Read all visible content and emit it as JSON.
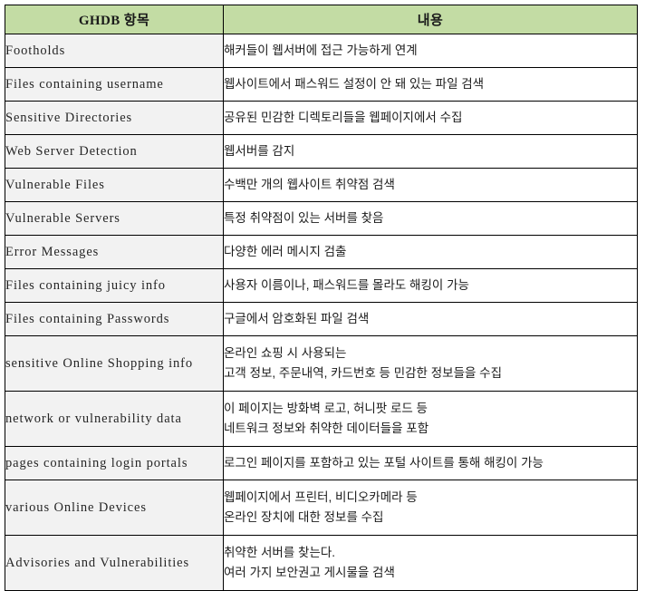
{
  "table": {
    "headers": {
      "term": "GHDB 항목",
      "description": "내용"
    },
    "header_bg": "#c3dca4",
    "term_bg": "#f2f2f2",
    "desc_bg": "#ffffff",
    "border_color": "#000000",
    "rows": [
      {
        "term": "Footholds",
        "lines": [
          "해커들이 웹서버에 접근 가능하게 연계"
        ]
      },
      {
        "term": "Files containing username",
        "lines": [
          "웹사이트에서 패스워드 설정이 안 돼 있는 파일 검색"
        ]
      },
      {
        "term": "Sensitive Directories",
        "lines": [
          "공유된 민감한 디렉토리들을 웹페이지에서 수집"
        ]
      },
      {
        "term": "Web Server Detection",
        "lines": [
          "웹서버를 감지"
        ]
      },
      {
        "term": "Vulnerable Files",
        "lines": [
          "수백만 개의 웹사이트 취약점 검색"
        ]
      },
      {
        "term": "Vulnerable Servers",
        "lines": [
          "특정 취약점이 있는 서버를 찾음"
        ]
      },
      {
        "term": "Error Messages",
        "lines": [
          "다양한 에러 메시지 검출"
        ]
      },
      {
        "term": "Files containing juicy info",
        "lines": [
          "사용자 이름이나, 패스워드를 몰라도 해킹이 가능"
        ]
      },
      {
        "term": "Files containing Passwords",
        "lines": [
          "구글에서 암호화된 파일 검색"
        ]
      },
      {
        "term": "sensitive Online Shopping info",
        "lines": [
          "온라인 쇼핑 시 사용되는",
          "고객 정보, 주문내역, 카드번호 등 민감한 정보들을 수집"
        ]
      },
      {
        "term": "network or vulnerability data",
        "lines": [
          "이 페이지는 방화벽 로고, 허니팟 로드 등",
          "네트워크 정보와 취약한 데이터들을 포함"
        ]
      },
      {
        "term": "pages containing login portals",
        "lines": [
          "로그인 페이지를 포함하고 있는 포털 사이트를 통해 해킹이 가능"
        ]
      },
      {
        "term": "various Online Devices",
        "lines": [
          "웹페이지에서 프린터, 비디오카메라 등",
          "온라인 장치에 대한 정보를 수집"
        ]
      },
      {
        "term": "Advisories and Vulnerabilities",
        "lines": [
          "취약한 서버를 찾는다.",
          "여러 가지 보안권고 게시물을 검색"
        ]
      }
    ]
  }
}
